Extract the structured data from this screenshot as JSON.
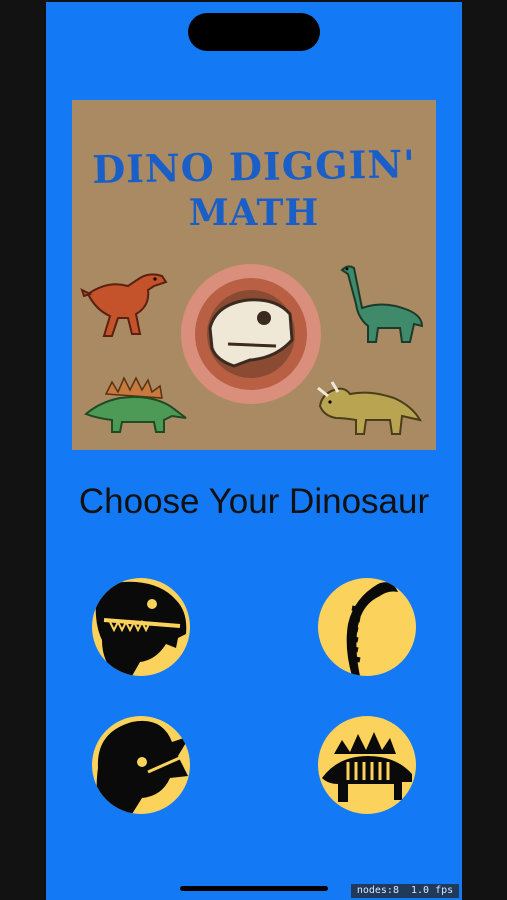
{
  "banner": {
    "title_line1": "DINO DIGGIN'",
    "title_line2": "MATH"
  },
  "heading": "Choose Your Dinosaur",
  "choices": [
    {
      "icon": "t-rex-skull-icon"
    },
    {
      "icon": "brachiosaurus-skeleton-icon"
    },
    {
      "icon": "triceratops-skull-icon"
    },
    {
      "icon": "stegosaurus-skeleton-icon"
    }
  ],
  "debug": {
    "stats": "nodes:8  1.0 fps"
  },
  "colors": {
    "background": "#1479f5",
    "banner": "#a98a63",
    "title": "#1a5fc8",
    "choice_circle": "#fbd25b"
  }
}
